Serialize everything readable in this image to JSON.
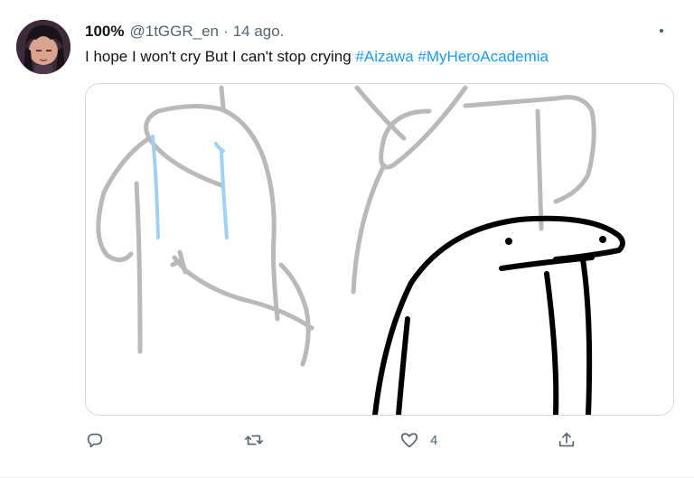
{
  "tweet": {
    "display_name": "100%",
    "handle": "@1tGGR_en",
    "separator": "·",
    "date": "14 ago.",
    "text_plain": "I hope I won't cry  But I can't stop crying ",
    "hashtags": [
      "#Aizawa",
      "#MyHeroAcademia"
    ],
    "more_icon": "more-horizontal-icon",
    "media": {
      "kind": "drawing"
    },
    "actions": {
      "reply": {
        "icon": "reply-icon",
        "count": ""
      },
      "retweet": {
        "icon": "retweet-icon",
        "count": ""
      },
      "like": {
        "icon": "heart-icon",
        "count": "4"
      },
      "share": {
        "icon": "share-icon",
        "count": ""
      }
    }
  },
  "colors": {
    "link": "#1d9bf0",
    "muted": "#536471",
    "text": "#0f1419",
    "border": "#cfd9de"
  }
}
